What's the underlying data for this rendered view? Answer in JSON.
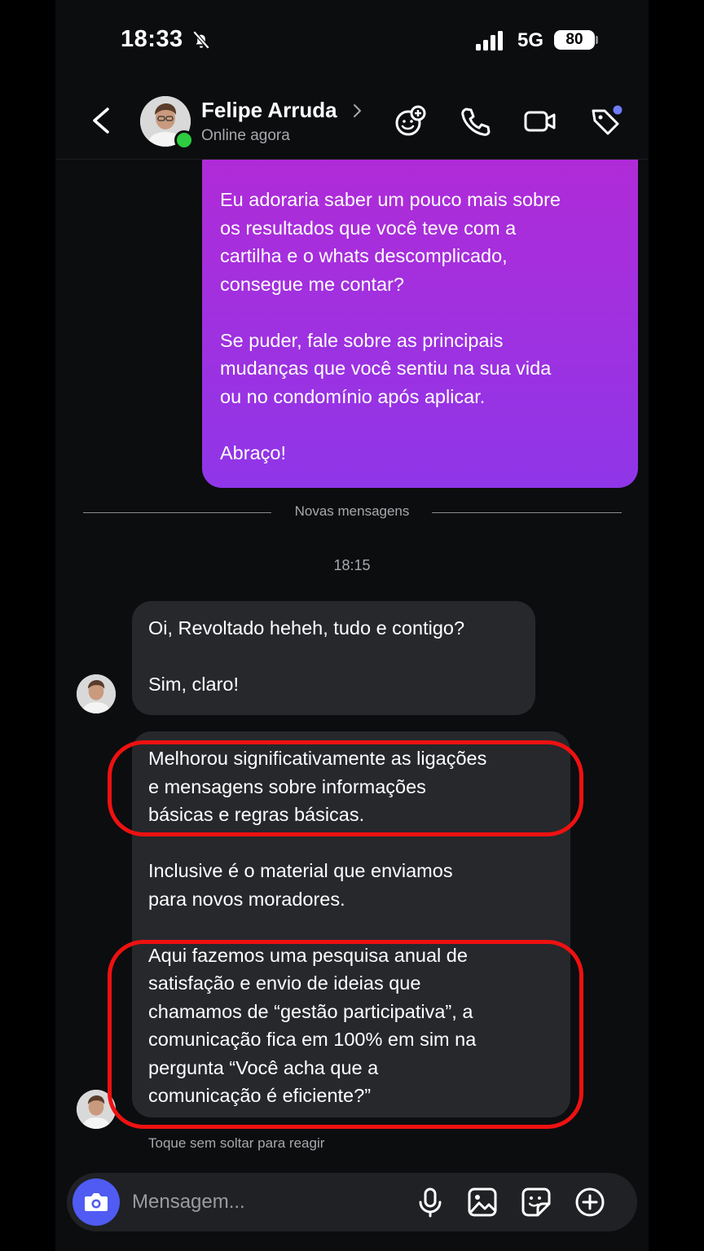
{
  "status_bar": {
    "time": "18:33",
    "network": "5G",
    "battery": "80"
  },
  "header": {
    "contact_name": "Felipe Arruda",
    "status": "Online agora"
  },
  "outgoing_message": {
    "text": "Eu adoraria saber um pouco mais sobre\nos resultados que você teve com a\ncartilha e o whats descomplicado,\nconsegue me contar?\n\nSe puder, fale sobre as principais\nmudanças que você sentiu na sua vida\nou no condomínio após aplicar.\n\nAbraço!"
  },
  "divider_label": "Novas mensagens",
  "timestamp": "18:15",
  "incoming_messages": [
    {
      "text": "Oi, Revoltado heheh, tudo e contigo?\n\nSim, claro!"
    },
    {
      "text": "Melhorou significativamente as ligações\ne mensagens sobre informações\nbásicas e regras básicas.\n\nInclusive é o material que enviamos\npara novos moradores.\n\nAqui fazemos uma pesquisa anual de\nsatisfação e envio de ideias que\nchamamos de “gestão participativa”, a\ncomunicação fica em 100% em sim na\npergunta “Você acha que a\ncomunicação é eficiente?”"
    }
  ],
  "reaction_hint": "Toque sem soltar para reagir",
  "composer": {
    "placeholder": "Mensagem..."
  },
  "colors": {
    "highlight": "#ee1111",
    "camera_button": "#4f5bf2",
    "online": "#2ecc40",
    "outgoing_start": "#b32ad6",
    "outgoing_end": "#8f36e8"
  }
}
